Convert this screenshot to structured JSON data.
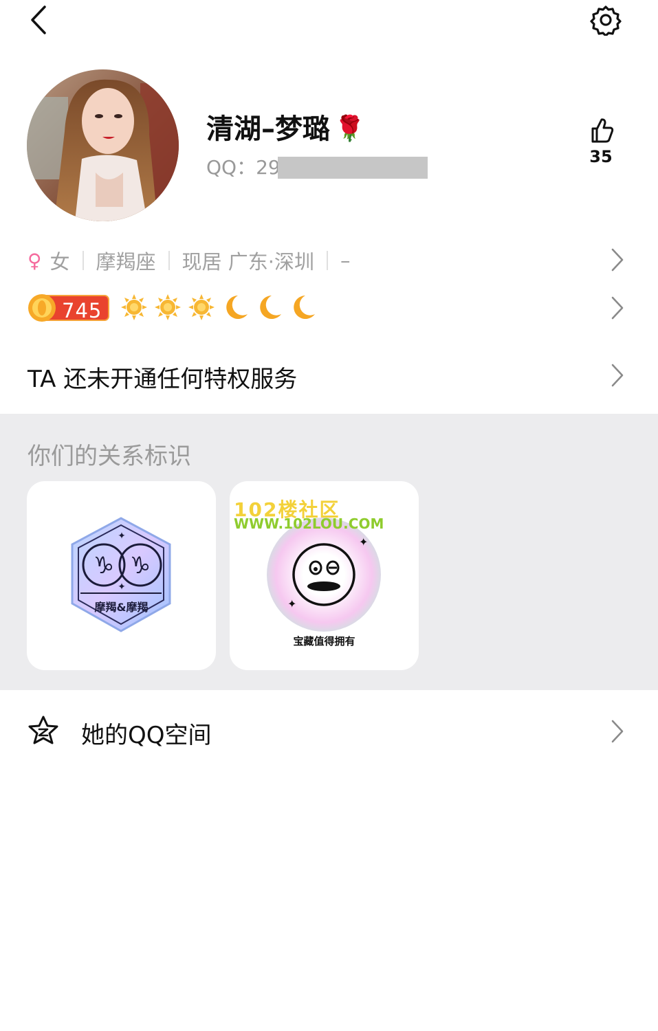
{
  "profile": {
    "nickname": "清湖–梦璐",
    "nickname_emoji": "🌹",
    "qq_prefix": "QQ：29",
    "likes": "35"
  },
  "info": {
    "gender_symbol": "♀",
    "gender": "女",
    "zodiac": "摩羯座",
    "location": "现居 广东·深圳",
    "extra": "–"
  },
  "level": {
    "value": "745",
    "icons": [
      "sun-icon",
      "sun-icon",
      "sun-icon",
      "moon-icon",
      "moon-icon",
      "moon-icon"
    ]
  },
  "vip": {
    "text": "TA 还未开通任何特权服务"
  },
  "relation": {
    "title": "你们的关系标识",
    "badges": [
      {
        "name": "capricorn-pair-badge",
        "label": "摩羯&摩羯"
      },
      {
        "name": "treasure-badge",
        "label": "宝藏值得拥有"
      }
    ],
    "watermark_line1": "102楼社区",
    "watermark_line2": "WWW.102LOU.COM"
  },
  "qzone": {
    "label": "她的QQ空间"
  },
  "colors": {
    "accent_orange": "#f07a2b",
    "level_red": "#e9432e",
    "sun": "#f7b733",
    "moon": "#f5a623",
    "gender_pink": "#f56a9d",
    "section_bg": "#ececee"
  }
}
